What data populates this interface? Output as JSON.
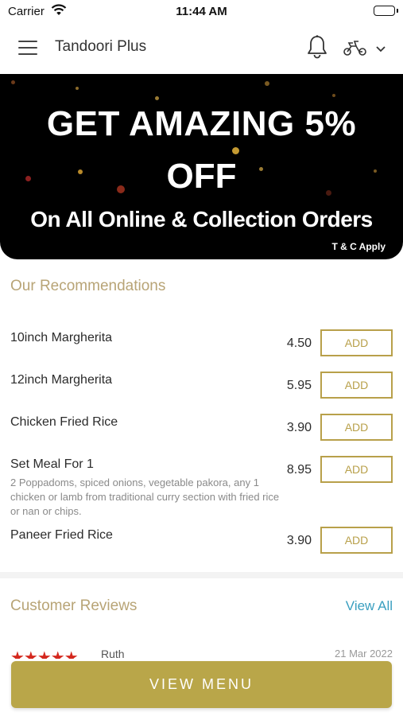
{
  "status_bar": {
    "carrier": "Carrier",
    "time": "11:44 AM"
  },
  "header": {
    "title": "Tandoori Plus",
    "icons": [
      "menu-icon",
      "bell-icon",
      "scooter-icon",
      "chevron-down-icon"
    ]
  },
  "banner": {
    "line1": "GET AMAZING 5%",
    "line2": "OFF",
    "line3": "On All Online & Collection Orders",
    "terms": "T & C Apply"
  },
  "recommendations": {
    "title": "Our Recommendations",
    "items": [
      {
        "name": "10inch Margherita",
        "price": "4.50",
        "description": "",
        "button": "ADD"
      },
      {
        "name": "12inch Margherita",
        "price": "5.95",
        "description": "",
        "button": "ADD"
      },
      {
        "name": "Chicken Fried Rice",
        "price": "3.90",
        "description": "",
        "button": "ADD"
      },
      {
        "name": "Set Meal For 1",
        "price": "8.95",
        "description": "2 Poppadoms, spiced onions, vegetable pakora, any 1 chicken or lamb from traditional curry section with fried rice or nan or chips.",
        "button": "ADD"
      },
      {
        "name": "Paneer Fried Rice",
        "price": "3.90",
        "description": "",
        "button": "ADD"
      }
    ]
  },
  "reviews": {
    "title": "Customer Reviews",
    "view_all": "View All",
    "first": {
      "stars": "★★★★★",
      "name": "Ruth",
      "date": "21 Mar 2022"
    }
  },
  "footer": {
    "button": "VIEW MENU"
  },
  "colors": {
    "accent_gold": "#b9a649",
    "section_title": "#b8a476",
    "link_blue": "#3a9fc0",
    "star_red": "#d4281e"
  }
}
